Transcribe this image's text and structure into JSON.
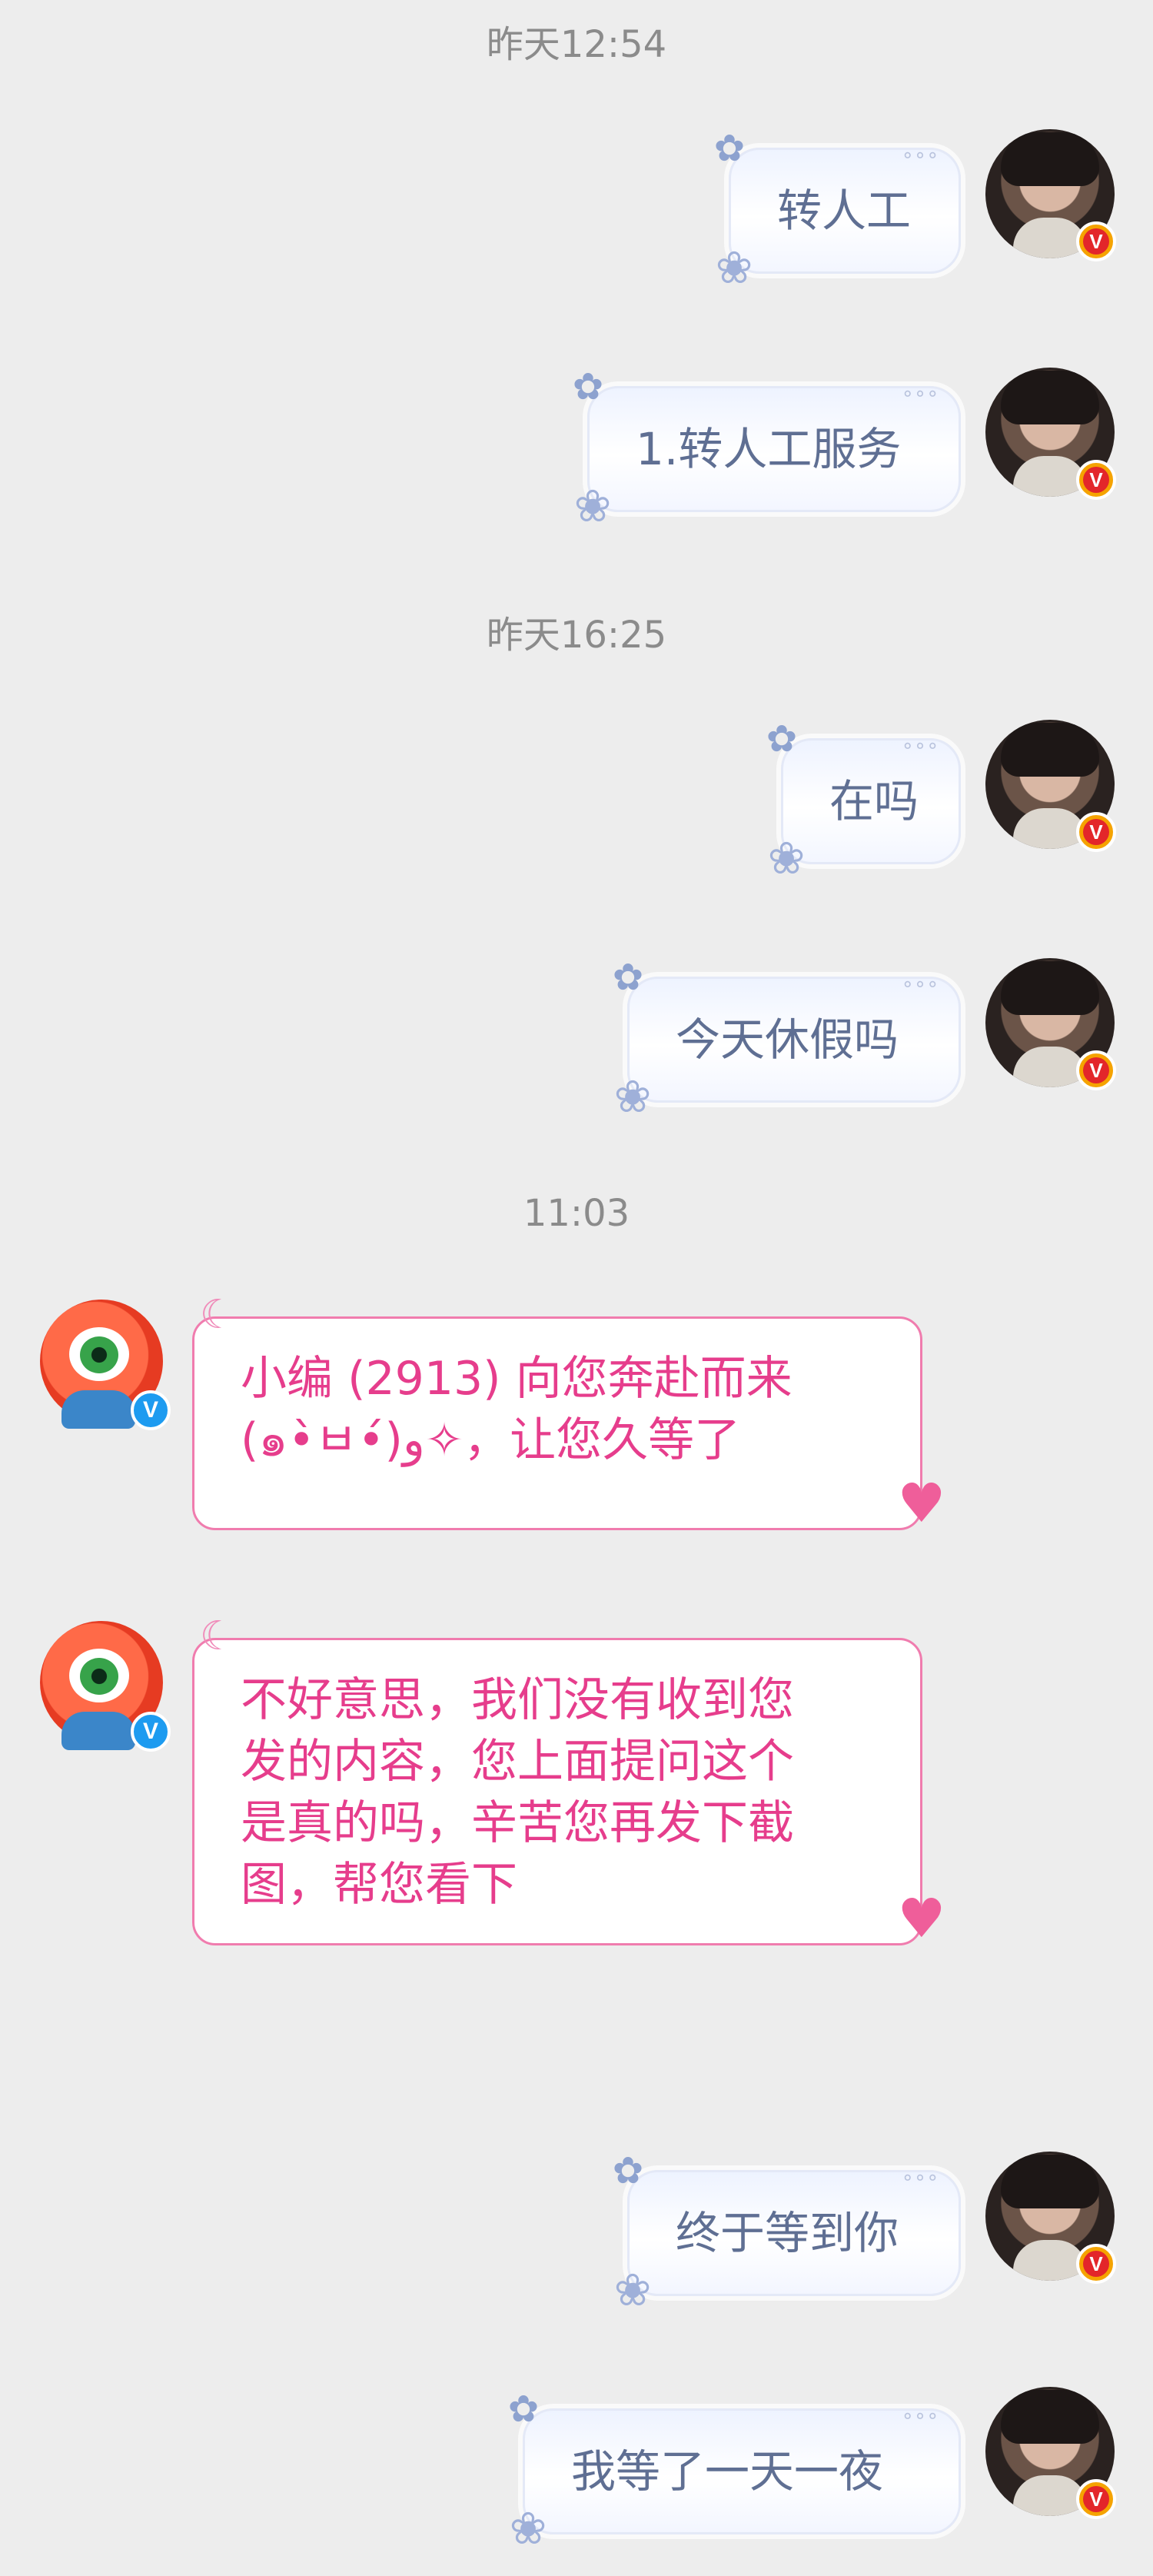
{
  "timestamps": [
    "昨天12:54",
    "昨天16:25",
    "11:03"
  ],
  "user_messages": [
    "转人工",
    "1.转人工服务",
    "在吗",
    "今天休假吗",
    "终于等到你",
    "我等了一天一夜"
  ],
  "bot_messages": [
    {
      "lines": [
        "小编 (2913) 向您奔赴而来",
        "(๑•̀ㅂ•́)و✧，让您久等了"
      ]
    },
    {
      "lines": [
        "不好意思，我们没有收到您",
        "发的内容，您上面提问这个",
        "是真的吗，辛苦您再发下截",
        "图，帮您看下"
      ]
    }
  ],
  "user_badge": "V",
  "bot_badge": "V",
  "icons": {
    "bubble_butterfly": "butterfly-icon",
    "bubble_flower": "flower-icon",
    "bot_moon": "moon-icon",
    "bot_bird": "bird-icon"
  },
  "colors": {
    "background": "#ededed",
    "user_text": "#5f6f93",
    "bot_text": "#e63d8c",
    "bot_border": "#f07cae",
    "timestamp": "#8b8b8b"
  }
}
